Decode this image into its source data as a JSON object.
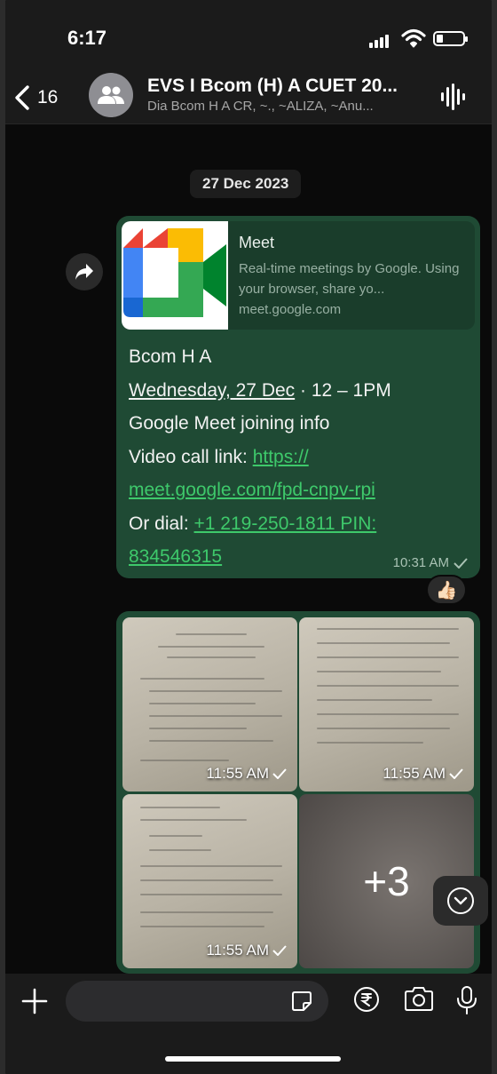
{
  "status": {
    "time": "6:17"
  },
  "header": {
    "back_count": "16",
    "title": "EVS I Bcom (H) A CUET 20...",
    "subtitle": "Dia Bcom H A CR, ~., ~ALIZA, ~Anu..."
  },
  "chat": {
    "date_chip": "27 Dec 2023",
    "message": {
      "preview_title": "Meet",
      "preview_desc": "Real-time meetings by Google. Using your browser, share yo...",
      "preview_link": "meet.google.com",
      "line1": "Bcom H A",
      "line2": "Wednesday, 27 Dec",
      "line2_rest": " · 12 – 1PM",
      "line3": "Google Meet joining info",
      "line4_label": "Video call link: ",
      "line4_link": "https://",
      "line5_link": "meet.google.com/fpd-cnpv-rpi",
      "line6_label": "Or dial: ",
      "line6_link": "+1 219-250-1811 PIN:",
      "line7_link": "834546315",
      "time": "10:31 AM",
      "reaction": "👍🏻"
    },
    "photos": {
      "p1_time": "11:55 AM",
      "p2_time": "11:55 AM",
      "p3_time": "11:55 AM",
      "more_count": "+3"
    }
  },
  "colors": {
    "bubble": "#1f4a34",
    "link": "#3ec96b",
    "background": "#0a0a0a"
  },
  "icons": [
    "back-chevron-icon",
    "group-avatar-icon",
    "audio-wave-icon",
    "forward-icon",
    "check-icon",
    "chevron-down-icon",
    "plus-icon",
    "sticker-icon",
    "rupee-icon",
    "camera-icon",
    "mic-icon"
  ]
}
